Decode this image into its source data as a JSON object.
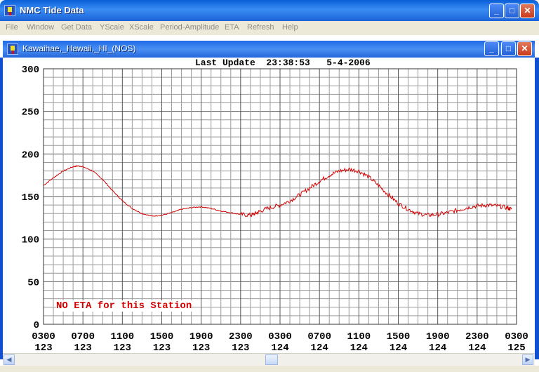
{
  "window": {
    "title": "NMC Tide Data",
    "minimize": "_",
    "maximize": "□",
    "close": "✕"
  },
  "menu": [
    "File",
    "Window",
    "Get Data",
    "YScale",
    "XScale",
    "Period-Amplitude",
    "ETA",
    "Refresh",
    "Help"
  ],
  "child_window": {
    "title": "Kawaihae,_Hawaii,_HI_(NOS)"
  },
  "last_update": "Last Update  23:38:53   5-4-2006",
  "eta_message": "NO ETA for this Station",
  "chart_data": {
    "type": "line",
    "ylim": [
      0,
      300
    ],
    "yticks": [
      0,
      50,
      100,
      150,
      200,
      250,
      300
    ],
    "xticks": [
      {
        "time": "0300",
        "day": "123"
      },
      {
        "time": "0700",
        "day": "123"
      },
      {
        "time": "1100",
        "day": "123"
      },
      {
        "time": "1500",
        "day": "123"
      },
      {
        "time": "1900",
        "day": "123"
      },
      {
        "time": "2300",
        "day": "123"
      },
      {
        "time": "0300",
        "day": "124"
      },
      {
        "time": "0700",
        "day": "124"
      },
      {
        "time": "1100",
        "day": "124"
      },
      {
        "time": "1500",
        "day": "124"
      },
      {
        "time": "1900",
        "day": "124"
      },
      {
        "time": "2300",
        "day": "124"
      },
      {
        "time": "0300",
        "day": "125"
      }
    ],
    "grid": true,
    "series": [
      {
        "color": "#d40000",
        "points": [
          [
            0,
            163
          ],
          [
            1,
            172
          ],
          [
            2,
            180
          ],
          [
            3,
            185
          ],
          [
            3.5,
            186
          ],
          [
            4,
            185
          ],
          [
            5,
            180
          ],
          [
            6,
            170
          ],
          [
            7,
            157
          ],
          [
            8,
            145
          ],
          [
            9,
            136
          ],
          [
            10,
            130
          ],
          [
            11,
            127
          ],
          [
            12,
            128
          ],
          [
            13,
            131
          ],
          [
            14,
            135
          ],
          [
            15,
            137
          ],
          [
            16,
            138
          ],
          [
            17,
            136
          ],
          [
            18,
            133
          ],
          [
            19,
            131
          ],
          [
            20,
            129
          ],
          [
            21,
            128
          ],
          [
            21.5,
            130
          ],
          [
            22,
            133
          ],
          [
            23,
            137
          ],
          [
            24,
            140
          ],
          [
            25,
            145
          ],
          [
            26,
            152
          ],
          [
            27,
            160
          ],
          [
            28,
            168
          ],
          [
            29,
            175
          ],
          [
            30,
            180
          ],
          [
            31,
            182
          ],
          [
            32,
            180
          ],
          [
            33,
            173
          ],
          [
            34,
            163
          ],
          [
            35,
            152
          ],
          [
            36,
            142
          ],
          [
            37,
            135
          ],
          [
            38,
            130
          ],
          [
            39,
            128
          ],
          [
            40,
            129
          ],
          [
            41,
            131
          ],
          [
            42,
            134
          ],
          [
            43,
            137
          ],
          [
            44,
            139
          ],
          [
            45,
            140
          ],
          [
            46,
            139
          ],
          [
            47,
            137
          ],
          [
            47.5,
            135
          ]
        ]
      }
    ]
  }
}
